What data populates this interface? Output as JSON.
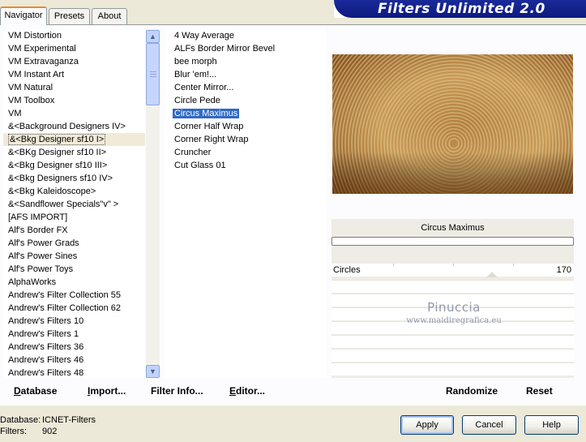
{
  "tabs": [
    {
      "label": "Navigator",
      "active": true
    },
    {
      "label": "Presets"
    },
    {
      "label": "About"
    }
  ],
  "banner": {
    "title": "Filters Unlimited 2.0"
  },
  "categories": [
    "VM Distortion",
    "VM Experimental",
    "VM Extravaganza",
    "VM Instant Art",
    "VM Natural",
    "VM Toolbox",
    "VM",
    "&<Background Designers IV>",
    "&<Bkg Designer sf10 I>",
    "&<BKg Designer sf10 II>",
    "&<Bkg Designer sf10 III>",
    "&<Bkg Designers sf10 IV>",
    "&<Bkg Kaleidoscope>",
    "&<Sandflower Specials\"v\" >",
    "[AFS IMPORT]",
    "Alf's Border FX",
    "Alf's Power Grads",
    "Alf's Power Sines",
    "Alf's Power Toys",
    "AlphaWorks",
    "Andrew's Filter Collection 55",
    "Andrew's Filter Collection 62",
    "Andrew's Filters 10",
    "Andrew's Filters 1",
    "Andrew's Filters 36",
    "Andrew's Filters 46",
    "Andrew's Filters 48"
  ],
  "selected_category": "&<Bkg Designer sf10 I>",
  "filters": [
    "4 Way Average",
    "ALFs Border Mirror Bevel",
    "bee morph",
    "Blur 'em!...",
    "Center Mirror...",
    "Circle Pede",
    "Circus Maximus",
    "Corner Half Wrap",
    "Corner Right Wrap",
    "Cruncher",
    "Cut Glass 01"
  ],
  "selected_filter": "Circus Maximus",
  "filter_panel": {
    "name": "Circus Maximus",
    "param_label": "Circles",
    "param_value": "170"
  },
  "watermark": {
    "title": "Pinuccia",
    "url": "www.maidiregrafica.eu"
  },
  "panel_buttons": {
    "database": "Database",
    "import": "Import...",
    "filter_info": "Filter Info...",
    "editor": "Editor...",
    "randomize": "Randomize",
    "reset": "Reset"
  },
  "footer": {
    "database_label": "Database:",
    "database_value": "ICNET-Filters",
    "filters_label": "Filters:",
    "filters_value": "902"
  },
  "dialog_buttons": {
    "apply": "Apply",
    "cancel": "Cancel",
    "help": "Help"
  },
  "colors": {
    "accent": "#316ac5",
    "banner": "#0d1a7e",
    "preview_dark": "#7a4718",
    "preview_light": "#e6cf97"
  }
}
